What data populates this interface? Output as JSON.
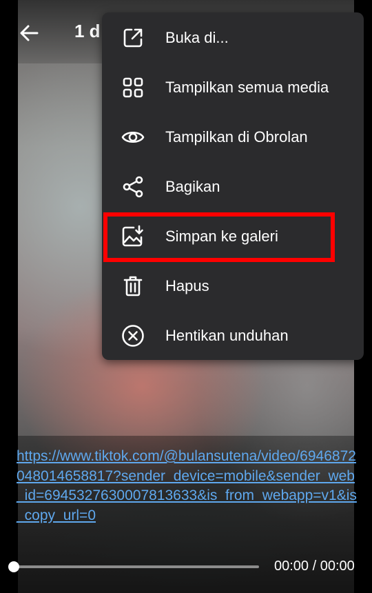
{
  "header": {
    "title": "1 d",
    "back_icon": "arrow-left-icon"
  },
  "menu": {
    "items": [
      {
        "label": "Buka di...",
        "icon": "open-external-icon"
      },
      {
        "label": "Tampilkan semua media",
        "icon": "grid-icon"
      },
      {
        "label": "Tampilkan di Obrolan",
        "icon": "eye-icon"
      },
      {
        "label": "Bagikan",
        "icon": "share-icon"
      },
      {
        "label": "Simpan ke galeri",
        "icon": "save-gallery-icon",
        "highlighted": true
      },
      {
        "label": "Hapus",
        "icon": "trash-icon"
      },
      {
        "label": "Hentikan unduhan",
        "icon": "cancel-circle-icon"
      }
    ],
    "highlight_color": "#ff0000"
  },
  "caption": {
    "link_text": "https://www.tiktok.com/@bulansutena/video/6946872048014658817?sender_device=mobile&sender_web_id=6945327630007813633&is_from_webapp=v1&is_copy_url=0"
  },
  "player": {
    "time_text": "00:00 / 00:00",
    "progress": 0
  },
  "colors": {
    "menu_bg": "#2b2b2d",
    "link": "#5fa8ee",
    "text": "#ffffff"
  }
}
